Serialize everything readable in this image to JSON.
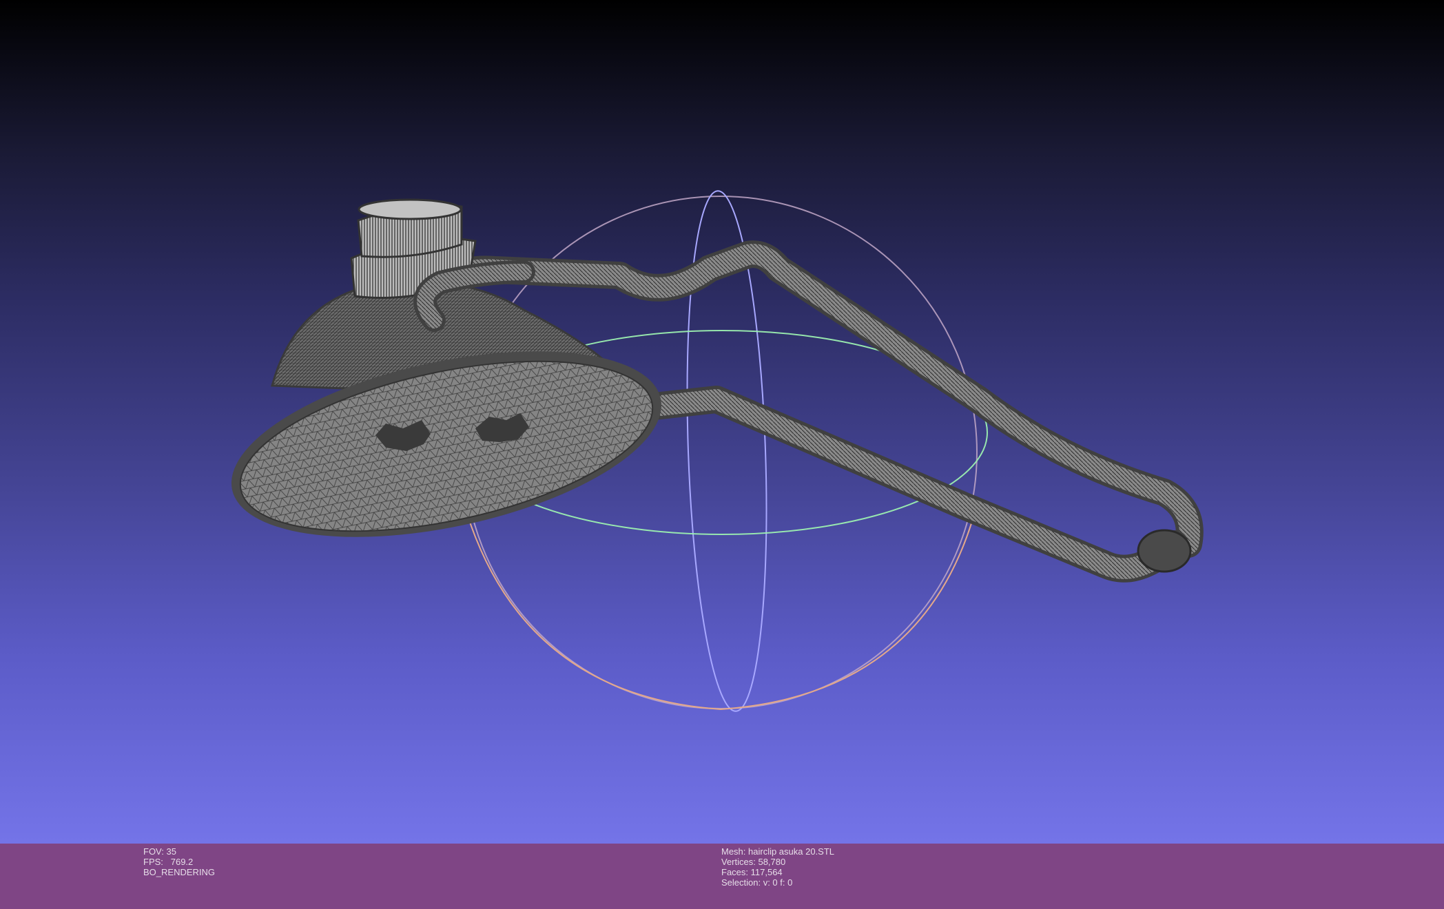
{
  "viewport": {
    "background_top": "#000000",
    "background_bottom": "#7474e8",
    "trackball_colors": {
      "x_ring": "#c2a8c8",
      "y_ring": "#a8a8ff",
      "z_ring": "#9cf0b0"
    },
    "mesh_color": "#7a7a7a"
  },
  "status_bar": {
    "color": "#7f4585",
    "left": {
      "fov": "FOV: 35",
      "fps": "FPS:   769.2",
      "mode": "BO_RENDERING"
    },
    "right": {
      "mesh": "Mesh: hairclip asuka 20.STL",
      "vertices": "Vertices: 58,780",
      "faces": "Faces: 117,564",
      "selection": "Selection: v: 0 f: 0"
    }
  }
}
